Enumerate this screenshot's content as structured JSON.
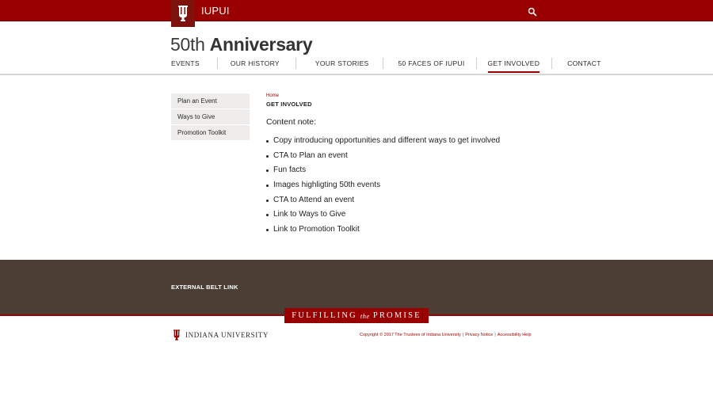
{
  "header": {
    "brand": "IUPUI",
    "title_light": "50th ",
    "title_bold": "Anniversary"
  },
  "nav": {
    "items": [
      {
        "label": "EVENTS"
      },
      {
        "label": "OUR HISTORY"
      },
      {
        "label": "YOUR STORIES"
      },
      {
        "label": "50 FACES OF IUPUI"
      },
      {
        "label": "GET INVOLVED",
        "active": true
      },
      {
        "label": "CONTACT"
      }
    ]
  },
  "sidebar": {
    "items": [
      {
        "label": "Plan an Event"
      },
      {
        "label": "Ways to Give"
      },
      {
        "label": "Promotion Toolkit"
      }
    ]
  },
  "main": {
    "breadcrumb": "Home",
    "page_title": "GET INVOLVED",
    "content_note": "Content note:",
    "bullets": [
      "Copy introducing opportunities and different ways to get involved",
      "CTA to Plan an event",
      "Fun facts",
      "Images highligting 50th events",
      "CTA to Attend an event",
      "Link to Ways to Give",
      "Link to Promotion Toolkit"
    ]
  },
  "footer": {
    "belt_link": "EXTERNAL BELT LINK",
    "promise_left": "FULFILLING",
    "promise_mid": "the",
    "promise_right": "PROMISE",
    "iu_name": "INDIANA UNIVERSITY",
    "copyright_prefix": "Copyright © 2017 The Trustees of ",
    "copyright_link": "Indiana University",
    "privacy": "Privacy Notice",
    "accessibility": "Accessibility Help",
    "separator": "|"
  },
  "icons": {
    "trident": "iu-trident-icon",
    "search": "search-icon"
  },
  "colors": {
    "crimson": "#990000",
    "dark_crimson": "#7d110c",
    "belt_brown": "#4b3f35",
    "subnav_bg": "#eeedeb"
  }
}
